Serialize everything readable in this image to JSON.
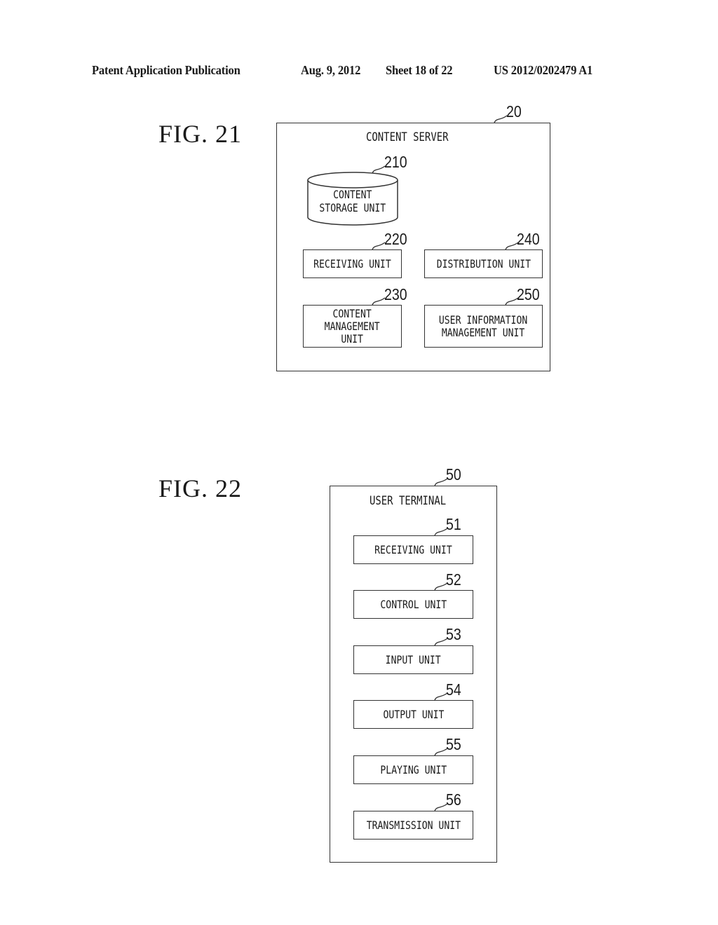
{
  "header": {
    "publication": "Patent Application Publication",
    "date": "Aug. 9, 2012",
    "sheet": "Sheet 18 of 22",
    "number": "US 2012/0202479 A1"
  },
  "fig21": {
    "label": "FIG. 21",
    "container": {
      "ref": "20",
      "title": "CONTENT SERVER"
    },
    "storage": {
      "ref": "210",
      "text": "CONTENT\nSTORAGE UNIT"
    },
    "units": [
      {
        "ref": "220",
        "text": "RECEIVING UNIT"
      },
      {
        "ref": "240",
        "text": "DISTRIBUTION UNIT"
      },
      {
        "ref": "230",
        "text": "CONTENT\nMANAGEMENT\nUNIT"
      },
      {
        "ref": "250",
        "text": "USER INFORMATION\nMANAGEMENT UNIT"
      }
    ]
  },
  "fig22": {
    "label": "FIG. 22",
    "container": {
      "ref": "50",
      "title": "USER TERMINAL"
    },
    "units": [
      {
        "ref": "51",
        "text": "RECEIVING UNIT"
      },
      {
        "ref": "52",
        "text": "CONTROL UNIT"
      },
      {
        "ref": "53",
        "text": "INPUT UNIT"
      },
      {
        "ref": "54",
        "text": "OUTPUT UNIT"
      },
      {
        "ref": "55",
        "text": "PLAYING UNIT"
      },
      {
        "ref": "56",
        "text": "TRANSMISSION UNIT"
      }
    ]
  }
}
